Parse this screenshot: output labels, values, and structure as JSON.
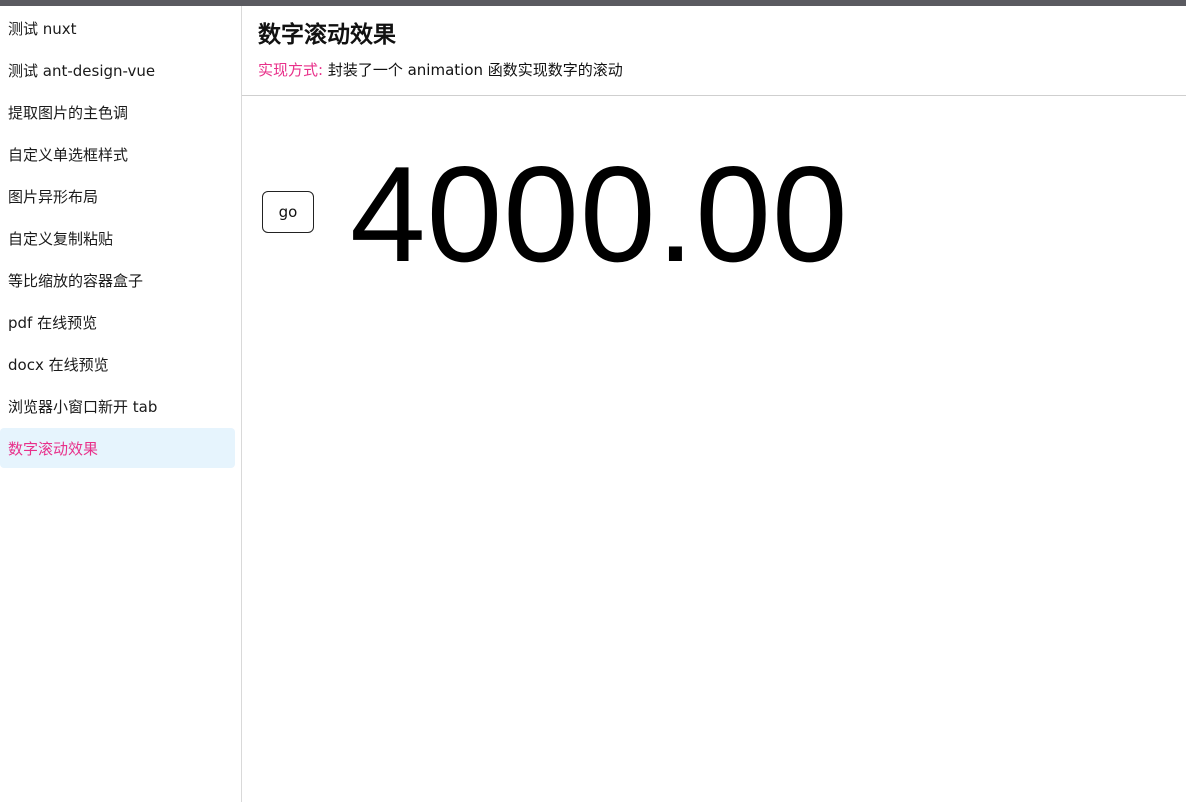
{
  "sidebar": {
    "items": [
      {
        "label": "测试 nuxt"
      },
      {
        "label": "测试 ant-design-vue"
      },
      {
        "label": "提取图片的主色调"
      },
      {
        "label": "自定义单选框样式"
      },
      {
        "label": "图片异形布局"
      },
      {
        "label": "自定义复制粘贴"
      },
      {
        "label": "等比缩放的容器盒子"
      },
      {
        "label": "pdf 在线预览"
      },
      {
        "label": "docx 在线预览"
      },
      {
        "label": "浏览器小窗口新开 tab"
      },
      {
        "label": "数字滚动效果",
        "active": true
      }
    ]
  },
  "header": {
    "title": "数字滚动效果",
    "desc_label": "实现方式:",
    "desc_text": "封装了一个 animation 函数实现数字的滚动"
  },
  "content": {
    "go_label": "go",
    "number": "4000.00"
  },
  "colors": {
    "accent": "#e8308a",
    "active_bg": "#e6f4fd",
    "topbar": "#5a5a60"
  }
}
